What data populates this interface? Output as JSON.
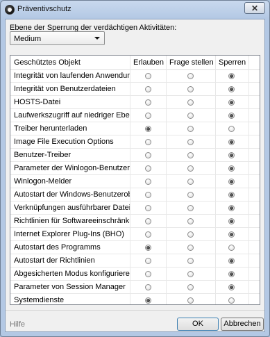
{
  "window": {
    "title": "Präventivschutz",
    "close_label": "✕"
  },
  "level": {
    "label": "Ebene der Sperrung der verdächtigen Aktivitäten:",
    "selected": "Medium"
  },
  "table": {
    "headers": [
      "Geschütztes Objekt",
      "Erlauben",
      "Frage stellen",
      "Sperren"
    ],
    "rows": [
      {
        "object": "Integrität von laufenden Anwendungen",
        "selected": 2
      },
      {
        "object": "Integrität von Benutzerdateien",
        "selected": 2
      },
      {
        "object": "HOSTS-Datei",
        "selected": 2
      },
      {
        "object": "Laufwerkszugriff auf niedriger Ebene",
        "selected": 2
      },
      {
        "object": "Treiber herunterladen",
        "selected": 0
      },
      {
        "object": "Image File Execution Options",
        "selected": 2
      },
      {
        "object": "Benutzer-Treiber",
        "selected": 2
      },
      {
        "object": "Parameter der Winlogon-Benutzerob...",
        "selected": 2
      },
      {
        "object": "Winlogon-Melder",
        "selected": 2
      },
      {
        "object": "Autostart der Windows-Benutzerobe...",
        "selected": 2
      },
      {
        "object": "Verknüpfungen ausführbarer Dateien",
        "selected": 2
      },
      {
        "object": "Richtlinien für Softwareeinschränkun...",
        "selected": 2
      },
      {
        "object": "Internet Explorer Plug-Ins (BHO)",
        "selected": 2
      },
      {
        "object": "Autostart des Programms",
        "selected": 0
      },
      {
        "object": "Autostart der Richtlinien",
        "selected": 2
      },
      {
        "object": "Abgesicherten Modus konfigurieren",
        "selected": 2
      },
      {
        "object": "Parameter von Session Manager",
        "selected": 2
      },
      {
        "object": "Systemdienste",
        "selected": 0
      }
    ]
  },
  "footer": {
    "help": "Hilfe",
    "ok": "OK",
    "cancel": "Abbrechen"
  }
}
